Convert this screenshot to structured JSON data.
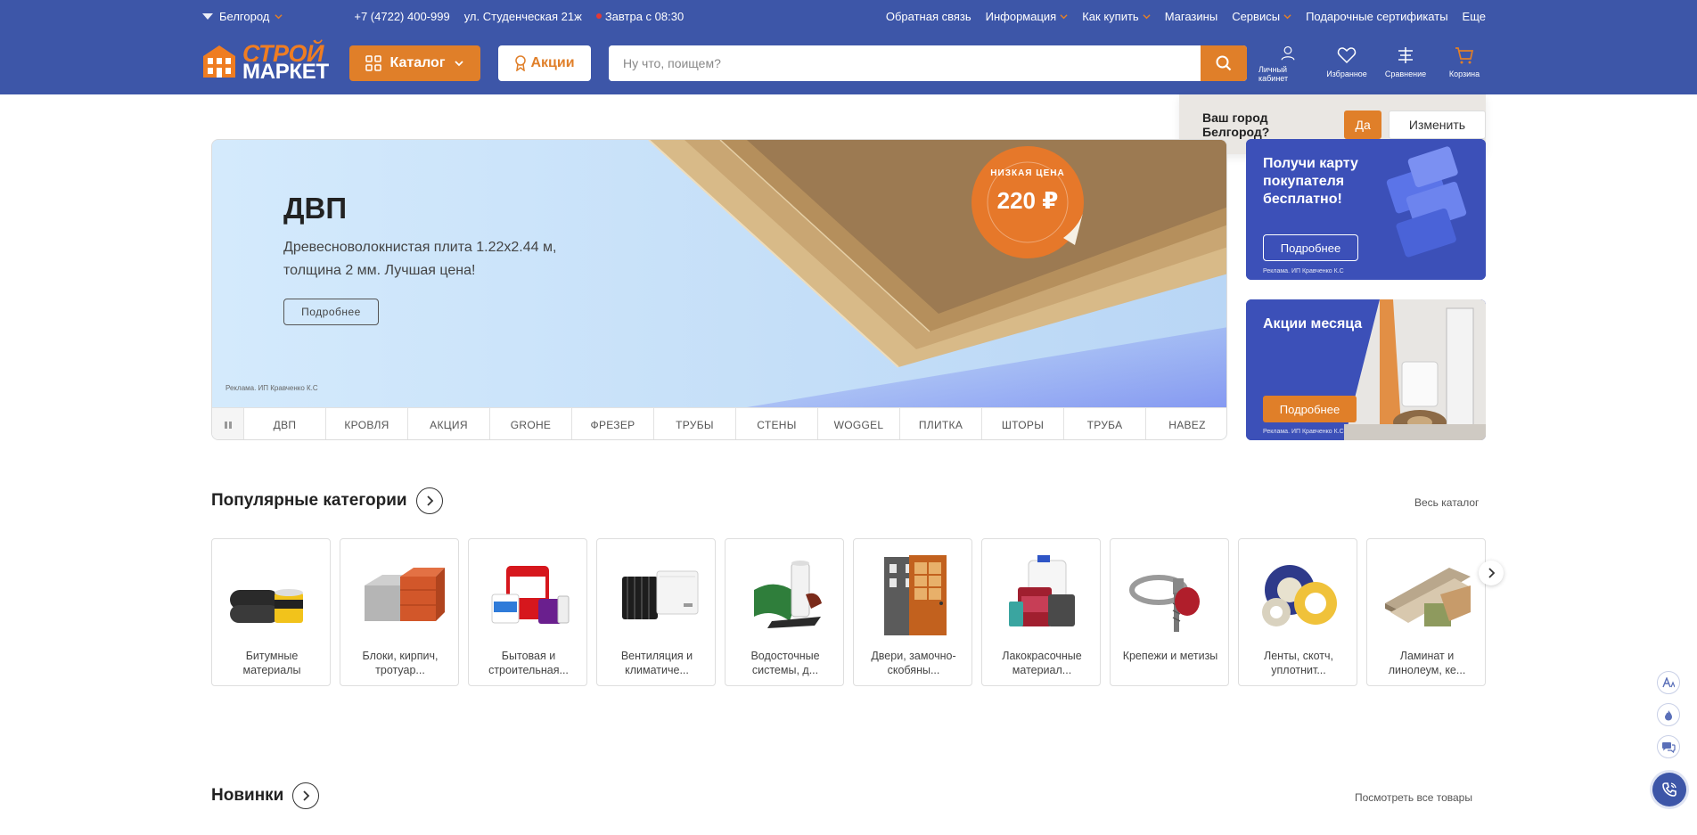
{
  "topbar": {
    "city": "Белгород",
    "phone": "+7 (4722) 400-999",
    "address": "ул. Студенческая 21ж",
    "schedule": "Завтра с 08:30",
    "links": [
      "Обратная связь",
      "Информация",
      "Как купить",
      "Магазины",
      "Сервисы",
      "Подарочные сертификаты",
      "Еще"
    ]
  },
  "header": {
    "logo_top": "СТРОЙ",
    "logo_bottom": "МАРКЕТ",
    "catalog_label": "Каталог",
    "promo_label": "Акции",
    "search_placeholder": "Ну что, поищем?",
    "icons": [
      {
        "label": "Личный кабинет",
        "icon": "user-icon"
      },
      {
        "label": "Избранное",
        "icon": "heart-icon"
      },
      {
        "label": "Сравнение",
        "icon": "compare-icon"
      },
      {
        "label": "Корзина",
        "icon": "cart-icon"
      }
    ]
  },
  "city_popup": {
    "question": "Ваш город Белгород?",
    "yes": "Да",
    "change": "Изменить"
  },
  "main_banner": {
    "title": "ДВП",
    "description": "Древесноволокнистая плита 1.22x2.44 м, толщина 2 мм. Лучшая цена!",
    "button": "Подробнее",
    "ad_note": "Реклама. ИП Кравченко К.С",
    "sticker_top": "НИЗКАЯ ЦЕНА",
    "sticker_price": "220 ₽",
    "tabs": [
      "ДВП",
      "КРОВЛЯ",
      "АКЦИЯ",
      "GROHE",
      "ФРЕЗЕР",
      "ТРУБЫ",
      "СТЕНЫ",
      "WOGGEL",
      "ПЛИТКА",
      "ШТОРЫ",
      "ТРУБА",
      "HABEZ"
    ]
  },
  "side_banners": [
    {
      "title": "Получи карту покупателя бесплатно!",
      "button": "Подробнее",
      "ad_note": "Реклама. ИП Кравченко К.С"
    },
    {
      "title": "Акции месяца",
      "button": "Подробнее",
      "ad_note": "Реклама. ИП Кравченко К.С"
    }
  ],
  "popular": {
    "title": "Популярные категории",
    "link": "Весь каталог",
    "items": [
      {
        "label": "Битумные материалы"
      },
      {
        "label": "Блоки, кирпич, тротуар..."
      },
      {
        "label": "Бытовая и строительная..."
      },
      {
        "label": "Вентиляция и климатиче..."
      },
      {
        "label": "Водосточные системы, д..."
      },
      {
        "label": "Двери, замочно-скобяны..."
      },
      {
        "label": "Лакокрасочные материал..."
      },
      {
        "label": "Крепежи и метизы"
      },
      {
        "label": "Ленты, скотч, уплотнит..."
      },
      {
        "label": "Ламинат и линолеум, ке..."
      }
    ]
  },
  "news": {
    "title": "Новинки",
    "link": "Посмотреть все товары"
  },
  "colors": {
    "brand_blue": "#3d56a8",
    "accent_orange": "#e07f29"
  }
}
